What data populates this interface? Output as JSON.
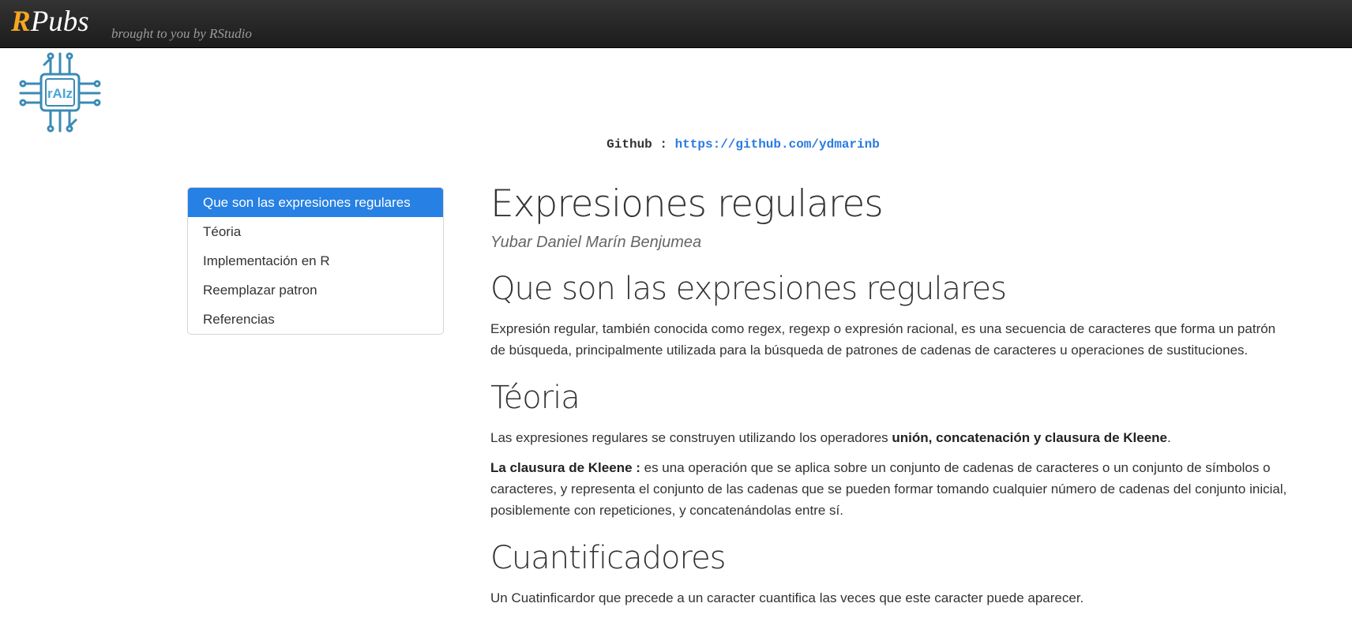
{
  "header": {
    "brand_r": "R",
    "brand_rest": "Pubs",
    "tagline": "brought to you by RStudio"
  },
  "logo": {
    "text": "rAIz",
    "icon": "circuit-chip-logo",
    "color": "#3a8bb5"
  },
  "github": {
    "label": "Github",
    "separator": " : ",
    "url": "https://github.com/ydmarinb"
  },
  "toc": {
    "items": [
      "Que son las expresiones regulares",
      "Téoria",
      "Implementación en R",
      "Reemplazar patron",
      "Referencias"
    ],
    "active_index": 0,
    "accent": "#2780e3"
  },
  "article": {
    "title": "Expresiones regulares",
    "author": "Yubar Daniel Marín Benjumea",
    "s1_heading": "Que son las expresiones regulares",
    "s1_p1": "Expresión regular, también conocida como regex, regexp o expresión racional, es una secuencia de caracteres que forma un patrón de búsqueda, principalmente utilizada para la búsqueda de patrones de cadenas de caracteres u operaciones de sustituciones.",
    "s2_heading": "Téoria",
    "s2_p1_pre": "Las expresiones regulares se construyen utilizando los operadores ",
    "s2_p1_bold": "unión, concatenación y clausura de Kleene",
    "s2_p1_post": ".",
    "s2_p2_bold": "La clausura de Kleene :",
    "s2_p2_rest": " es una operación que se aplica sobre un conjunto de cadenas de caracteres o un conjunto de símbolos o caracteres, y representa el conjunto de las cadenas que se pueden formar tomando cualquier número de cadenas del conjunto inicial, posiblemente con repeticiones, y concatenándolas entre sí.",
    "s3_heading": "Cuantificadores",
    "s3_p1": "Un Cuatinficardor que precede a un caracter cuantifica las veces que este caracter puede aparecer."
  }
}
